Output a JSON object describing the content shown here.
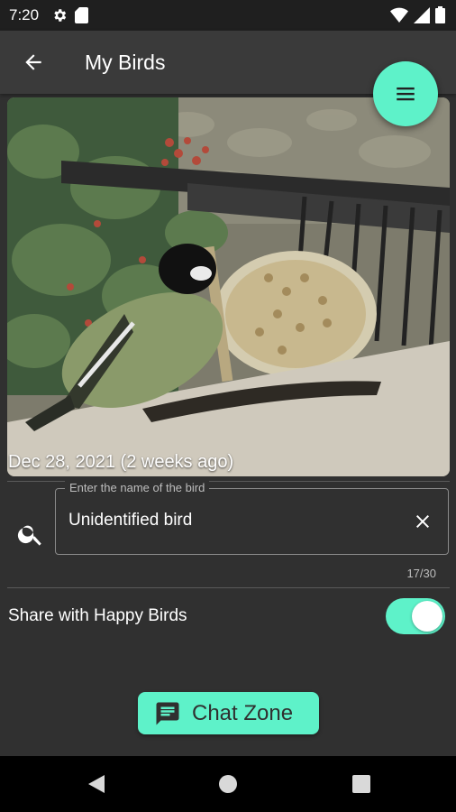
{
  "status_bar": {
    "time": "7:20",
    "left_icons": [
      "settings-icon",
      "sd-card-icon"
    ],
    "right_icons": [
      "wifi-icon",
      "signal-icon",
      "battery-icon"
    ]
  },
  "app_bar": {
    "title": "My Birds",
    "back_icon": "arrow-back-icon",
    "menu_icon": "menu-icon"
  },
  "photo": {
    "caption": "Dec 28, 2021 (2 weeks ago)"
  },
  "bird_name_field": {
    "label": "Enter the name of the bird",
    "value": "Unidentified bird",
    "char_count": "17/30",
    "search_icon": "search-icon",
    "clear_icon": "close-icon"
  },
  "share": {
    "label": "Share with Happy Birds",
    "enabled": true
  },
  "chat_button": {
    "label": "Chat Zone",
    "icon": "chat-icon"
  },
  "nav": {
    "buttons": [
      "back-triangle-icon",
      "home-circle-icon",
      "recents-square-icon"
    ]
  },
  "colors": {
    "accent": "#5ef2c9",
    "background": "#303030",
    "app_bar": "#3a3a3a"
  }
}
